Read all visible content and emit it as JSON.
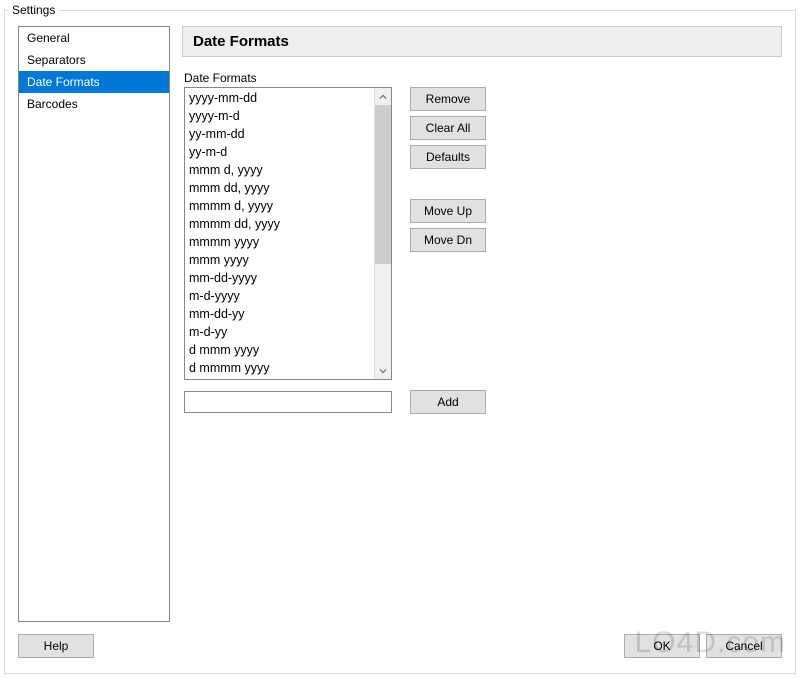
{
  "window": {
    "title": "Settings"
  },
  "sidebar": {
    "items": [
      {
        "label": "General",
        "selected": false
      },
      {
        "label": "Separators",
        "selected": false
      },
      {
        "label": "Date Formats",
        "selected": true
      },
      {
        "label": "Barcodes",
        "selected": false
      }
    ]
  },
  "panel": {
    "header": "Date Formats",
    "list_label": "Date Formats",
    "formats": [
      "yyyy-mm-dd",
      "yyyy-m-d",
      "yy-mm-dd",
      "yy-m-d",
      "mmm d, yyyy",
      "mmm dd, yyyy",
      "mmmm d, yyyy",
      "mmmm dd, yyyy",
      "mmmm yyyy",
      "mmm yyyy",
      "mm-dd-yyyy",
      "m-d-yyyy",
      "mm-dd-yy",
      "m-d-yy",
      "d mmm yyyy",
      "d mmmm yyyy"
    ],
    "new_format_value": "",
    "buttons": {
      "remove": "Remove",
      "clear_all": "Clear All",
      "defaults": "Defaults",
      "move_up": "Move Up",
      "move_dn": "Move Dn",
      "add": "Add"
    }
  },
  "footer": {
    "help": "Help",
    "ok": "OK",
    "cancel": "Cancel"
  },
  "watermark": "LO4D.com"
}
